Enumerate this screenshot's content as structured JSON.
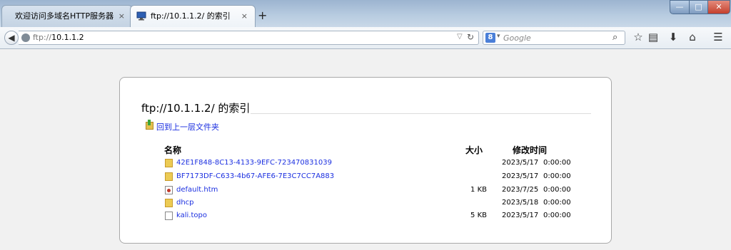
{
  "browser": {
    "tabs": [
      {
        "label": "欢迎访问多域名HTTP服务器",
        "close": "×"
      },
      {
        "label": "ftp://10.1.1.2/ 的索引",
        "close": "×"
      }
    ],
    "new_tab": "+",
    "window_buttons": {
      "minimize": "—",
      "maximize": "□",
      "close": "✕"
    },
    "address": {
      "scheme": "ftp://",
      "host": "10.1.1.2"
    },
    "search_placeholder": "Google",
    "search_engine_letter": "8"
  },
  "page": {
    "heading": "ftp://10.1.1.2/ 的索引",
    "up_link": "回到上一层文件夹",
    "columns": {
      "name": "名称",
      "size": "大小",
      "modified": "修改时间"
    },
    "entries": [
      {
        "name": "42E1F848-8C13-4133-9EFC-723470831039",
        "size": "",
        "date": "2023/5/17",
        "time": "0:00:00",
        "icon": "folder-icon"
      },
      {
        "name": "BF7173DF-C633-4b67-AFE6-7E3C7CC7A883",
        "size": "",
        "date": "2023/5/17",
        "time": "0:00:00",
        "icon": "folder-icon"
      },
      {
        "name": "default.htm",
        "size": "1 KB",
        "date": "2023/7/25",
        "time": "0:00:00",
        "icon": "html-file-icon"
      },
      {
        "name": "dhcp",
        "size": "",
        "date": "2023/5/18",
        "time": "0:00:00",
        "icon": "folder-icon"
      },
      {
        "name": "kali.topo",
        "size": "5 KB",
        "date": "2023/5/17",
        "time": "0:00:00",
        "icon": "file-icon"
      }
    ]
  }
}
